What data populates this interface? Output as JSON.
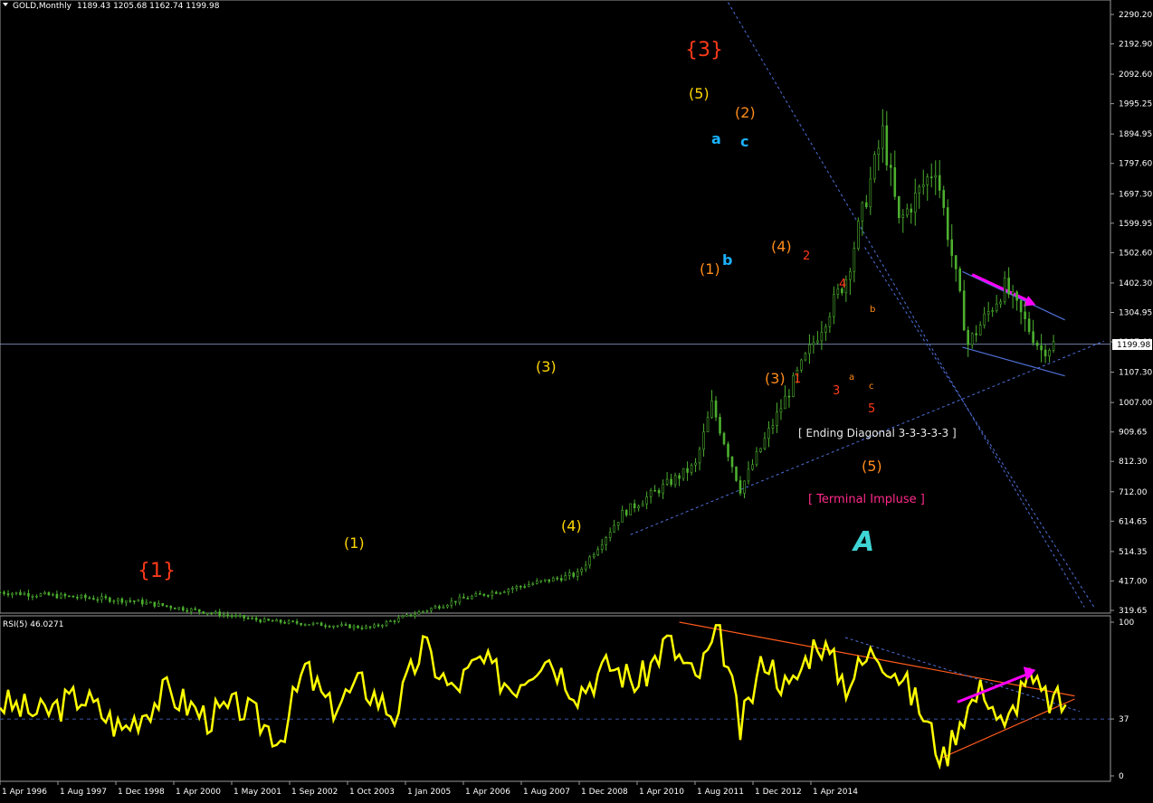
{
  "header": {
    "symbol": "GOLD,Monthly",
    "ohlc": "1189.43 1205.68 1162.74 1199.98"
  },
  "rsi_header": "RSI(5) 46.0271",
  "current_price_label": "1199.98",
  "x_axis_labels": [
    "1 Apr 1996",
    "1 Aug 1997",
    "1 Dec 1998",
    "1 Apr 2000",
    "1 May 2001",
    "1 Sep 2002",
    "1 Oct 2003",
    "1 Jan 2005",
    "1 Apr 2006",
    "1 Aug 2007",
    "1 Dec 2008",
    "1 Apr 2010",
    "1 Aug 2011",
    "1 Dec 2012",
    "1 Apr 2014"
  ],
  "colors": {
    "candles": "#4caf2f",
    "rsi": "#ffff00",
    "trendline": "#4f6fd8",
    "wave_orange": "#ff8c1a",
    "wave_red": "#ff3a1a",
    "wave_yellow": "#ffd700",
    "wave_cyan": "#1ab2ff",
    "magenta": "#ff00ff"
  },
  "annotations": {
    "w1_big": "{1}",
    "w3_big": "{3}",
    "y1": "(1)",
    "y3": "(3)",
    "y4": "(4)",
    "y5": "(5)",
    "o1": "(1)",
    "o2": "(2)",
    "o3": "(3)",
    "o4": "(4)",
    "o5": "(5)",
    "a": "a",
    "b": "b",
    "c": "c",
    "r1": "1",
    "r2": "2",
    "r3": "3",
    "r4": "4",
    "r5": "5",
    "sa": "a",
    "sb": "b",
    "sc": "c",
    "ending_diagonal": "[ Ending Diagonal 3-3-3-3-3 ]",
    "terminal_impulse": "[ Terminal Impluse ]",
    "logo": "A"
  },
  "chart_data": [
    {
      "type": "candlestick",
      "title": "GOLD,Monthly",
      "ylim": [
        319.65,
        2290.2
      ],
      "y_ticks": [
        "2290.20",
        "2192.90",
        "2092.60",
        "1995.25",
        "1894.95",
        "1797.60",
        "1697.30",
        "1599.95",
        "1502.60",
        "1402.30",
        "1304.95",
        "1207.60",
        "1107.30",
        "1007.00",
        "909.65",
        "812.30",
        "712.00",
        "614.65",
        "514.35",
        "417.00",
        "319.65"
      ],
      "x_time_range": [
        "1993-08",
        "2016-05"
      ],
      "x": [
        "1993-08",
        "1996-04",
        "1999-01",
        "2001-03",
        "2003-01",
        "2005-06",
        "2006-05",
        "2007-11",
        "2008-03",
        "2008-10",
        "2009-12",
        "2010-12",
        "2011-09",
        "2012-01",
        "2012-10",
        "2013-06",
        "2014-03",
        "2014-12",
        "2015-03"
      ],
      "close": [
        380,
        352,
        285,
        262,
        356,
        440,
        640,
        800,
        1000,
        720,
        1100,
        1420,
        1900,
        1600,
        1790,
        1200,
        1390,
        1180,
        1200
      ],
      "last_ohlc": {
        "open": 1189.43,
        "high": 1205.68,
        "low": 1162.74,
        "close": 1199.98
      }
    },
    {
      "type": "line",
      "title": "RSI(5) 46.0271",
      "ylim": [
        0,
        100
      ],
      "y_ticks": [
        "100",
        "37",
        "0"
      ],
      "reference_line": 37,
      "x": [
        "1993-08",
        "1994-06",
        "1995-04",
        "1996-02",
        "1997-01",
        "1997-11",
        "1998-07",
        "1999-05",
        "1999-11",
        "2000-05",
        "2001-01",
        "2001-09",
        "2002-04",
        "2002-11",
        "2003-06",
        "2004-02",
        "2004-10",
        "2005-06",
        "2006-02",
        "2006-09",
        "2007-04",
        "2007-11",
        "2008-05",
        "2008-10",
        "2009-04",
        "2009-10",
        "2010-05",
        "2010-12",
        "2011-07",
        "2011-12",
        "2012-06",
        "2012-12",
        "2013-04",
        "2013-10",
        "2014-03",
        "2014-08",
        "2015-01",
        "2015-06"
      ],
      "values": [
        48,
        40,
        52,
        30,
        55,
        38,
        45,
        25,
        70,
        44,
        60,
        40,
        85,
        55,
        75,
        58,
        80,
        55,
        72,
        60,
        88,
        62,
        95,
        30,
        78,
        55,
        90,
        60,
        82,
        70,
        45,
        10,
        38,
        58,
        28,
        65,
        50,
        46
      ]
    }
  ]
}
